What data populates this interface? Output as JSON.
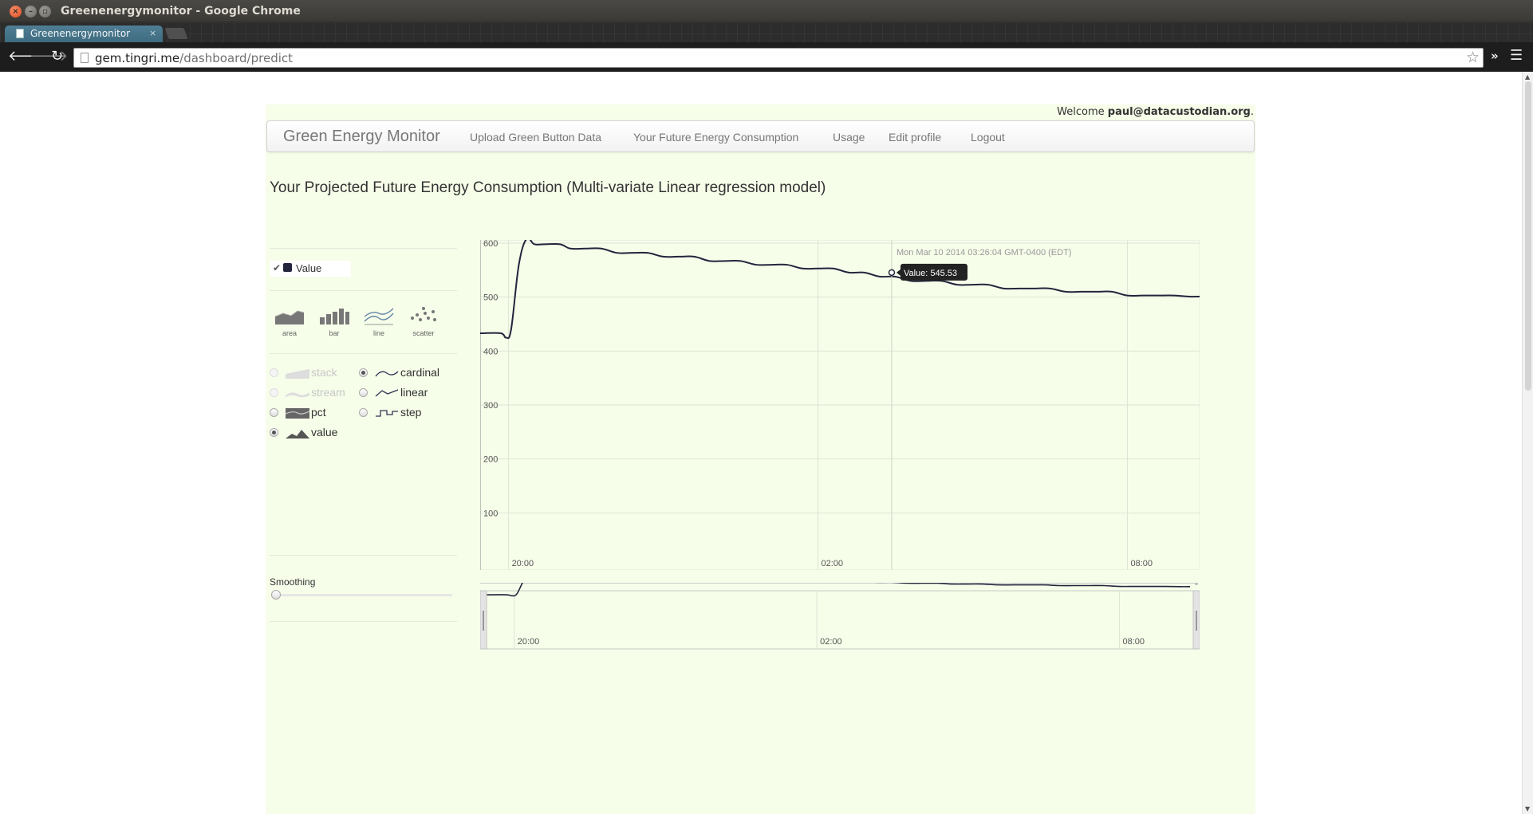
{
  "window": {
    "title": "Greenenergymonitor - Google Chrome",
    "tab_label": "Greenenergymonitor",
    "url_domain": "gem.tingri.me",
    "url_path": "/dashboard/predict"
  },
  "page": {
    "welcome_prefix": "Welcome ",
    "welcome_user": "paul@datacustodian.org",
    "welcome_suffix": ".",
    "brand": "Green Energy Monitor",
    "nav": [
      "Upload Green Button Data",
      "Your Future Energy Consumption",
      "Usage",
      "Edit profile",
      "Logout"
    ],
    "title": "Your Projected Future Energy Consumption (Multi-variate Linear regression model)"
  },
  "controls": {
    "legend": {
      "label": "Value",
      "checked": true,
      "color": "#23253d"
    },
    "renderers": [
      "area",
      "bar",
      "line",
      "scatter"
    ],
    "offsets": [
      {
        "label": "stack",
        "checked": false,
        "disabled": true
      },
      {
        "label": "stream",
        "checked": false,
        "disabled": true
      },
      {
        "label": "pct",
        "checked": false,
        "disabled": false
      },
      {
        "label": "value",
        "checked": true,
        "disabled": false
      }
    ],
    "interpolations": [
      {
        "label": "cardinal",
        "checked": true
      },
      {
        "label": "linear",
        "checked": false
      },
      {
        "label": "step",
        "checked": false
      }
    ],
    "smoothing_label": "Smoothing",
    "smoothing_value": 0
  },
  "chart_data": {
    "type": "line",
    "renderer": "line",
    "interpolation": "cardinal",
    "y_ticks": [
      100,
      200,
      300,
      400,
      500,
      600
    ],
    "ylim": [
      0,
      600
    ],
    "x_ticks": [
      "20:00",
      "02:00",
      "08:00"
    ],
    "x_tick_hours": [
      0,
      6,
      12
    ],
    "xlim_hours": [
      -0.55,
      13.4
    ],
    "series": [
      {
        "name": "Value",
        "color": "#23253d",
        "x_hours": [
          -0.55,
          -0.15,
          -0.05,
          0.05,
          0.2,
          0.35,
          0.5,
          0.7,
          1.0,
          1.2,
          1.5,
          1.8,
          2.1,
          2.4,
          2.7,
          3.0,
          3.3,
          3.6,
          3.9,
          4.2,
          4.5,
          4.8,
          5.1,
          5.4,
          5.7,
          6.0,
          6.3,
          6.6,
          6.9,
          7.2,
          7.5,
          7.8,
          8.1,
          8.4,
          8.7,
          9.0,
          9.3,
          9.6,
          9.9,
          10.2,
          10.5,
          10.8,
          11.1,
          11.4,
          11.7,
          12.0,
          12.3,
          12.6,
          12.9,
          13.2,
          13.4
        ],
        "values": [
          433,
          433,
          425,
          440,
          560,
          608,
          598,
          598,
          598,
          590,
          590,
          590,
          582,
          582,
          582,
          575,
          575,
          575,
          567,
          567,
          567,
          560,
          560,
          560,
          553,
          553,
          553,
          545.5,
          545.5,
          538,
          538,
          530,
          530,
          530,
          523,
          523,
          523,
          516,
          516,
          516,
          516,
          510,
          510,
          510,
          510,
          503,
          503,
          503,
          503,
          501,
          501
        ]
      }
    ],
    "hover": {
      "date_label": "Mon Mar 10 2014 03:26:04 GMT-0400 (EDT)",
      "value_label": "Value: 545.53",
      "x_hour": 7.43,
      "value": 545.53
    },
    "preview_x_ticks": [
      "20:00",
      "02:00",
      "08:00"
    ]
  }
}
